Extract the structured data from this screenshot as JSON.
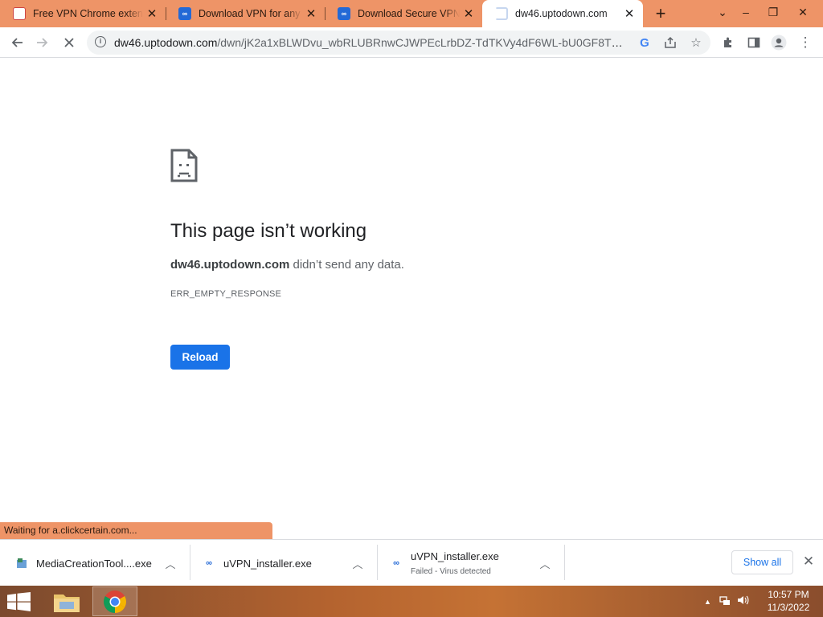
{
  "tabs": [
    {
      "title": "Free VPN Chrome extension",
      "favicon": "calendar-favicon",
      "active": false
    },
    {
      "title": "Download VPN for any device",
      "favicon": "uvpn-favicon",
      "active": false
    },
    {
      "title": "Download Secure VPN For Free",
      "favicon": "uvpn-favicon",
      "active": false
    },
    {
      "title": "dw46.uptodown.com",
      "favicon": "loading-spinner",
      "active": true
    }
  ],
  "toolbar": {
    "url_host": "dw46.uptodown.com",
    "url_path": "/dwn/jK2a1xBLWDvu_wbRLUBRnwCJWPEcLrbDZ-TdTKVy4dF6WL-bU0GF8T9tma0..."
  },
  "error_page": {
    "title": "This page isn’t working",
    "host": "dw46.uptodown.com",
    "desc_suffix": " didn’t send any data.",
    "code": "ERR_EMPTY_RESPONSE",
    "reload_label": "Reload"
  },
  "status_bubble": "Waiting for a.clickcertain.com...",
  "downloads": [
    {
      "name": "MediaCreationTool....exe",
      "status": ""
    },
    {
      "name": "uVPN_installer.exe",
      "status": ""
    },
    {
      "name": "uVPN_installer.exe",
      "status": "Failed - Virus detected"
    }
  ],
  "shelf": {
    "show_all_label": "Show all"
  },
  "taskbar": {
    "time": "10:57 PM",
    "date": "11/3/2022"
  },
  "colors": {
    "accent": "#1a73e8",
    "frame": "#ee9467"
  }
}
